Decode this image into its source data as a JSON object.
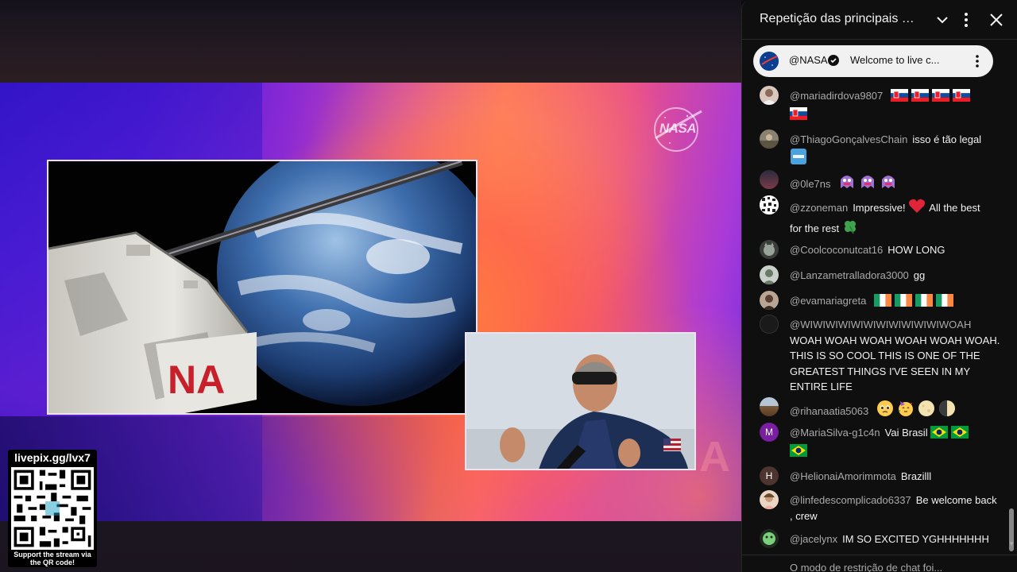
{
  "chat": {
    "title": "Repetição das principais mens...",
    "pinned": {
      "author": "@NASA",
      "text": "Welcome to live c..."
    },
    "messages": [
      {
        "author": "@mariadirdova9807",
        "text": "",
        "emojis": [
          "flag-sk",
          "flag-sk",
          "flag-sk",
          "flag-sk",
          "flag-sk"
        ]
      },
      {
        "author": "@ThiagoGonçalvesChain",
        "text": "isso é tão legal",
        "emojis": [
          "cool-icon"
        ]
      },
      {
        "author": "@0le7ns",
        "text": "",
        "emojis": [
          "ghost-emoji",
          "ghost-emoji",
          "ghost-emoji"
        ]
      },
      {
        "author": "@zzoneman",
        "text": "Impressive!",
        "text2": "All the best",
        "text3": "for the rest",
        "emojis": [
          "heart",
          "four-leaf-clover"
        ]
      },
      {
        "author": "@Coolcoconutcat16",
        "text": "HOW LONG"
      },
      {
        "author": "@Lanzametralladora3000",
        "text": "gg"
      },
      {
        "author": "@evamariagreta",
        "text": "",
        "emojis": [
          "flag-ie",
          "flag-ie",
          "flag-ie",
          "flag-ie"
        ]
      },
      {
        "author": "@WIWIWIWIWIWIWIWIWIWIWIWOAH",
        "text": "WOAH WOAH WOAH WOAH WOAH WOAH. THIS IS SO COOL THIS IS ONE OF THE GREATEST THINGS I'VE SEEN IN MY ENTIRE LIFE"
      },
      {
        "author": "@rihanaatia5063",
        "text": "",
        "emojis": [
          "pleading-face",
          "party-face",
          "moon",
          "moon"
        ]
      },
      {
        "author": "@MariaSilva-g1c4n",
        "text": "Vai Brasil",
        "avatar_letter": "M",
        "emojis": [
          "flag-br",
          "flag-br",
          "flag-br"
        ]
      },
      {
        "author": "@HelionaiAmorimmota",
        "text": "Brazilll",
        "avatar_letter": "H"
      },
      {
        "author": "@linfedescomplicado6337",
        "text": "Be welcome back , crew"
      },
      {
        "author": "@jacelynx",
        "text": "IM SO EXCITED YGHHHHHHH"
      }
    ],
    "footer_text": "O modo de restrição de chat foi..."
  },
  "overlay": {
    "qr_title": "livepix.gg/lvx7",
    "qr_caption": "Support the stream via the QR code!"
  },
  "video": {
    "nasa_logo_text": "NASA",
    "spacecraft_marking": "NA"
  },
  "colors": {
    "chat_bg": "#0f0f0f",
    "author_gray": "#aaaaaa",
    "text_white": "#f1f1f1",
    "pinned_bg": "#f1f1f1",
    "accent_purple": "#8a2ad4",
    "accent_orange": "#ff6f5c"
  }
}
